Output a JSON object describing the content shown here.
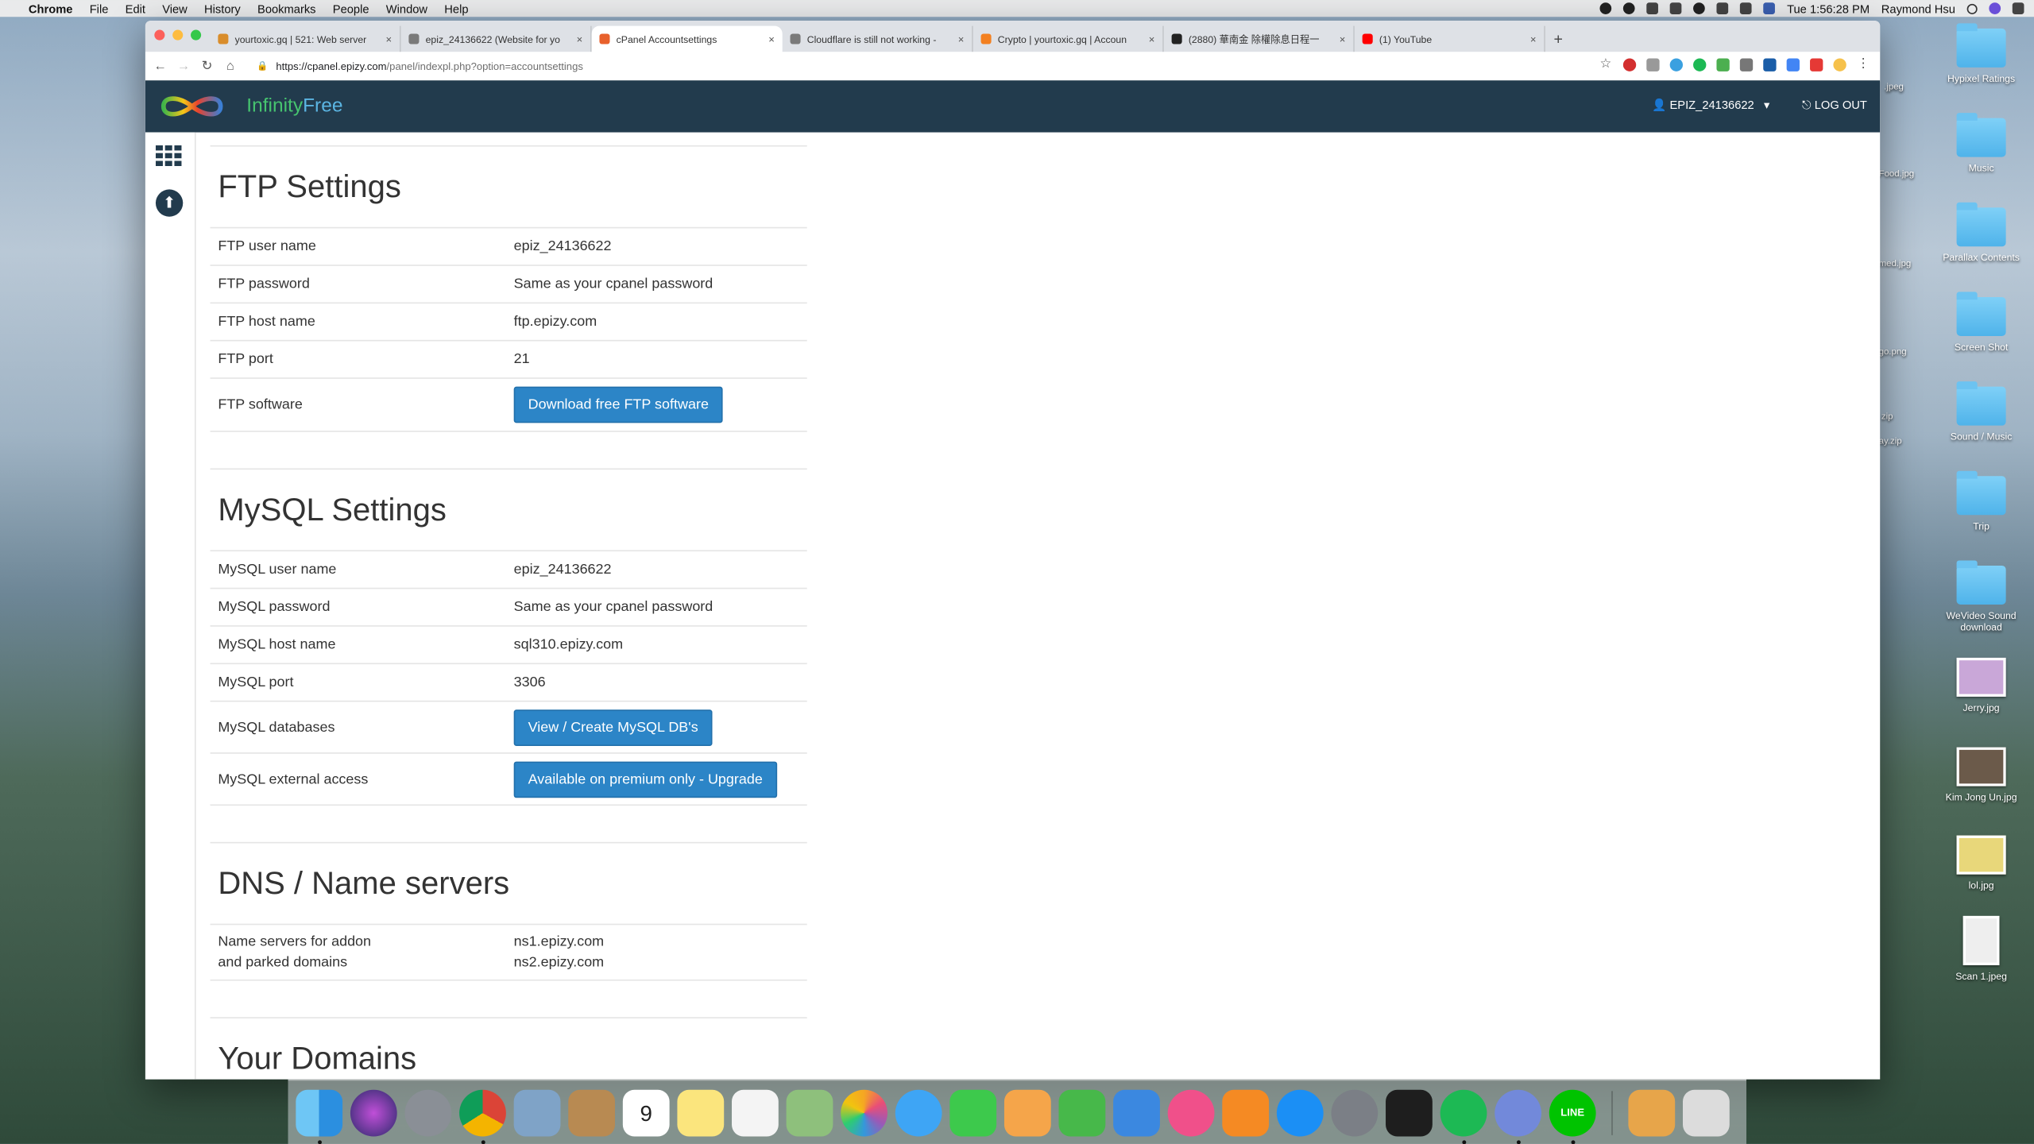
{
  "menubar": {
    "apple": "",
    "items": [
      "Chrome",
      "File",
      "Edit",
      "View",
      "History",
      "Bookmarks",
      "People",
      "Window",
      "Help"
    ],
    "clock": "Tue 1:56:28 PM",
    "user": "Raymond Hsu"
  },
  "tabs": [
    {
      "title": "yourtoxic.gq | 521: Web server",
      "close": "×",
      "color": "#d98d2b"
    },
    {
      "title": "epiz_24136622 (Website for yo",
      "close": "×",
      "color": "#7a7a7a"
    },
    {
      "title": "cPanel Accountsettings",
      "close": "×",
      "color": "#e8612c"
    },
    {
      "title": "Cloudflare is still not working -",
      "close": "×",
      "color": "#7a7a7a"
    },
    {
      "title": "Crypto | yourtoxic.gq | Accoun",
      "close": "×",
      "color": "#f38020"
    },
    {
      "title": "(2880) 華南金 除權除息日程一",
      "close": "×",
      "color": "#222222"
    },
    {
      "title": "(1) YouTube",
      "close": "×",
      "color": "#ff0000"
    }
  ],
  "new_tab": "+",
  "address": {
    "host": "https://cpanel.epizy.com",
    "path": "/panel/indexpl.php?option=accountsettings"
  },
  "site": {
    "brand_a": "Infinity",
    "brand_b": "Free",
    "user": "EPIZ_24136622",
    "caret": "▾",
    "logout": "LOG OUT"
  },
  "ftp": {
    "title": "FTP Settings",
    "rows": [
      {
        "k": "FTP user name",
        "v": "epiz_24136622"
      },
      {
        "k": "FTP password",
        "v": "Same as your cpanel password"
      },
      {
        "k": "FTP host name",
        "v": "ftp.epizy.com"
      },
      {
        "k": "FTP port",
        "v": "21"
      }
    ],
    "software_label": "FTP software",
    "software_button": "Download free FTP software"
  },
  "mysql": {
    "title": "MySQL Settings",
    "rows": [
      {
        "k": "MySQL user name",
        "v": "epiz_24136622"
      },
      {
        "k": "MySQL password",
        "v": "Same as your cpanel password"
      },
      {
        "k": "MySQL host name",
        "v": "sql310.epizy.com"
      },
      {
        "k": "MySQL port",
        "v": "3306"
      }
    ],
    "db_label": "MySQL databases",
    "db_button": "View / Create MySQL DB's",
    "ext_label": "MySQL external access",
    "ext_button": "Available on premium only - Upgrade"
  },
  "dns": {
    "title": "DNS / Name servers",
    "label_line1": "Name servers for addon",
    "label_line2": "and parked domains",
    "ns1": "ns1.epizy.com",
    "ns2": "ns2.epizy.com"
  },
  "domains": {
    "title": "Your Domains"
  },
  "desktop": [
    {
      "label": "Hypixel Ratings",
      "kind": "folder"
    },
    {
      "label": "Music",
      "kind": "folder"
    },
    {
      "label": "Parallax Contents",
      "kind": "folder"
    },
    {
      "label": "Screen Shot",
      "kind": "folder"
    },
    {
      "label": "Sound / Music",
      "kind": "folder"
    },
    {
      "label": "Trip",
      "kind": "folder"
    },
    {
      "label": "WeVideo Sound download",
      "kind": "folder"
    },
    {
      "label": "Jerry.jpg",
      "kind": "image"
    },
    {
      "label": "Kim Jong Un.jpg",
      "kind": "image"
    },
    {
      "label": "lol.jpg",
      "kind": "image"
    },
    {
      "label": "Scan 1.jpeg",
      "kind": "image"
    }
  ],
  "desktop_left": [
    ".jpeg",
    "Food.jpg",
    "med.jpg",
    "go.png",
    "zip",
    "ay.zip"
  ],
  "dock_apps": [
    "finder",
    "siri",
    "launchpad",
    "chrome",
    "preview",
    "contacts",
    "calendar",
    "notes",
    "reminders",
    "maps",
    "photos",
    "messages",
    "facetime",
    "pages",
    "numbers",
    "keynote",
    "itunes",
    "books",
    "app-store",
    "system-preferences",
    "activity-monitor",
    "spotify",
    "discord",
    "line",
    "archive",
    "trash"
  ]
}
